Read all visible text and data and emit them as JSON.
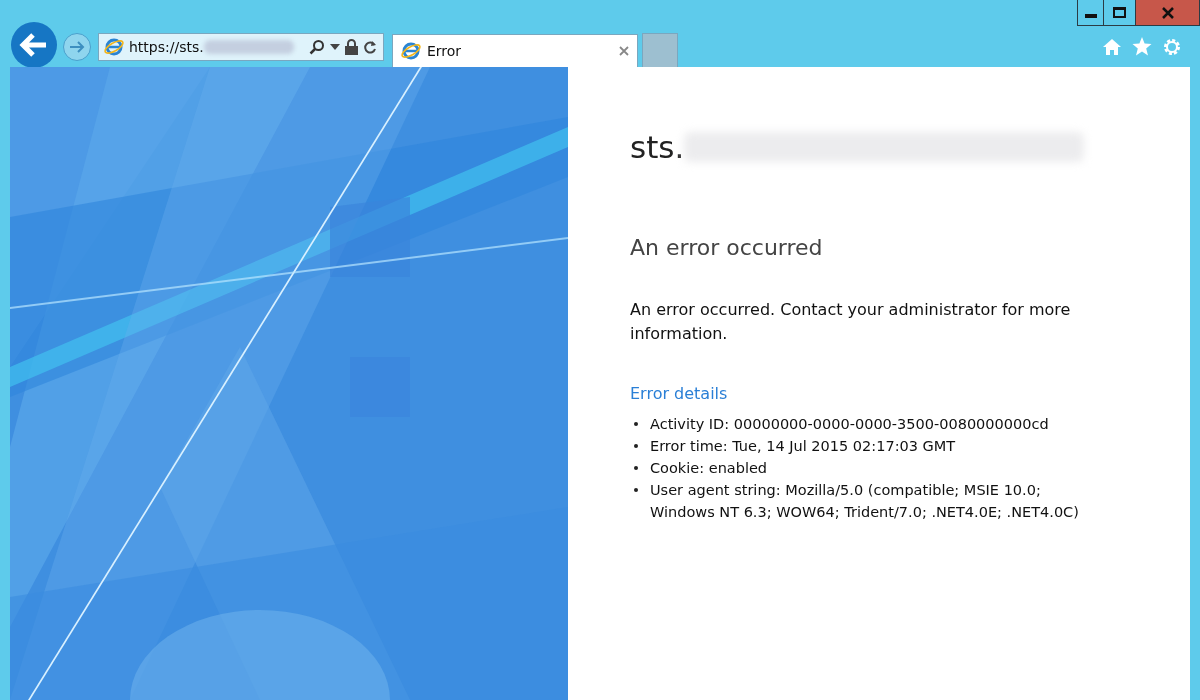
{
  "address_bar": {
    "url": "https://sts."
  },
  "tabs": [
    {
      "label": "Error",
      "selected": true
    }
  ],
  "page": {
    "site_title": "sts.",
    "heading": "An error occurred",
    "message": "An error occurred. Contact your administrator for more information.",
    "details_link": "Error details",
    "details": [
      "Activity ID: 00000000-0000-0000-3500-0080000000cd",
      "Error time: Tue, 14 Jul 2015 02:17:03 GMT",
      "Cookie: enabled",
      "User agent string: Mozilla/5.0 (compatible; MSIE 10.0; Windows NT 6.3; WOW64; Trident/7.0; .NET4.0E; .NET4.0C)"
    ]
  }
}
